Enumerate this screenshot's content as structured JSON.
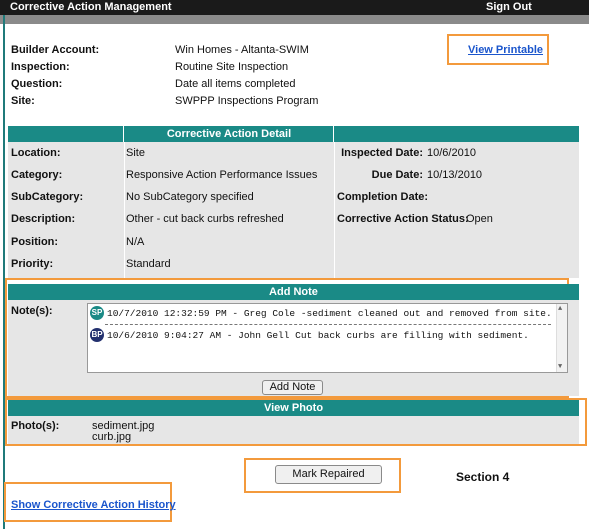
{
  "header": {
    "title": "Corrective Action Management",
    "sign_out": "Sign Out"
  },
  "info": {
    "builder_account": {
      "label": "Builder Account:",
      "value": "Win Homes - Altanta-SWIM"
    },
    "inspection": {
      "label": "Inspection:",
      "value": "Routine Site Inspection"
    },
    "question": {
      "label": "Question:",
      "value": "Date all items completed"
    },
    "site": {
      "label": "Site:",
      "value": "SWPPP Inspections Program"
    },
    "view_printable": "View Printable"
  },
  "detail": {
    "heading": "Corrective Action Detail",
    "left": [
      {
        "label": "Location:",
        "value": "Site"
      },
      {
        "label": "Category:",
        "value": "Responsive Action Performance Issues"
      },
      {
        "label": "SubCategory:",
        "value": "No SubCategory specified"
      },
      {
        "label": "Description:",
        "value": "Other - cut back curbs refreshed"
      },
      {
        "label": "Position:",
        "value": "N/A"
      },
      {
        "label": "Priority:",
        "value": "Standard"
      }
    ],
    "right": [
      {
        "label": "Inspected Date:",
        "value": "10/6/2010"
      },
      {
        "label": "Due Date:",
        "value": "10/13/2010"
      },
      {
        "label": "Completion Date:",
        "value": ""
      },
      {
        "label": "Corrective Action Status:",
        "value": "Open"
      }
    ]
  },
  "add_note": {
    "heading": "Add Note",
    "notes_label": "Note(s):",
    "notes": [
      {
        "badge": "SP",
        "badge_color": "#1a8a86",
        "text": "10/7/2010 12:32:59 PM - Greg Cole -sediment cleaned out and removed from site."
      },
      {
        "badge": "BP",
        "badge_color": "#23306e",
        "text": "10/6/2010 9:04:27 AM - John Gell Cut back curbs are filling with sediment."
      }
    ],
    "button": "Add Note"
  },
  "view_photo": {
    "heading": "View Photo",
    "label": "Photo(s):",
    "files": [
      "sediment.jpg",
      "curb.jpg"
    ]
  },
  "mark_repaired": "Mark Repaired",
  "section_label": "Section 4",
  "history_link": "Show Corrective Action History",
  "colors": {
    "teal": "#1a8a86",
    "highlight": "#f39a3c",
    "panel": "#e6e6e6"
  }
}
